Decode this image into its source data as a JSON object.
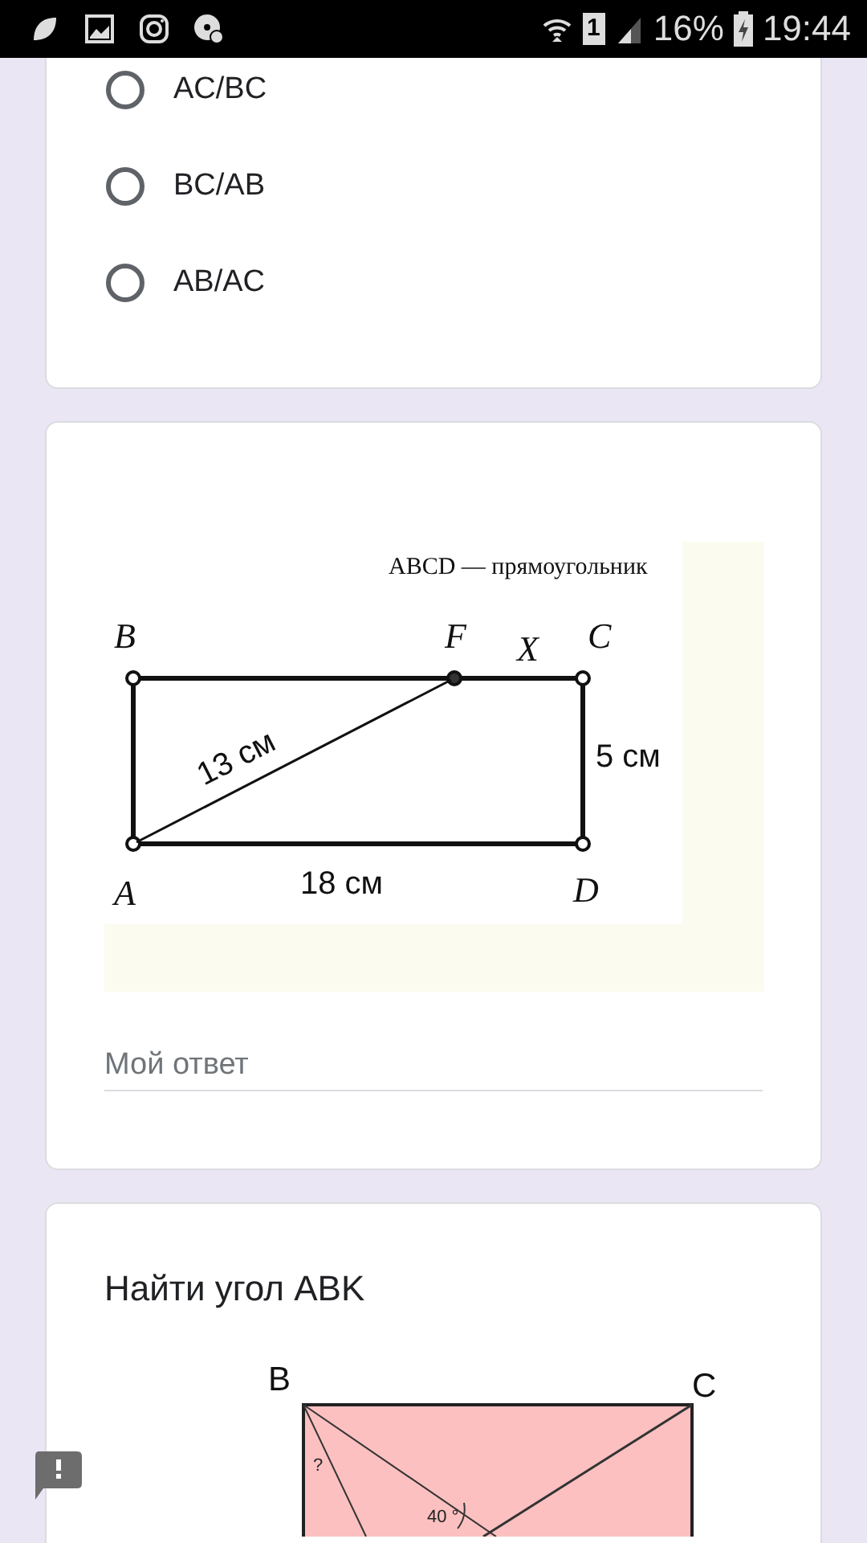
{
  "status_bar": {
    "sim_label": "1",
    "battery": "16%",
    "time": "19:44"
  },
  "question_1": {
    "options": [
      {
        "label": "AC/BC",
        "selected": false
      },
      {
        "label": "BC/AB",
        "selected": false
      },
      {
        "label": "AB/AC",
        "selected": false
      }
    ]
  },
  "question_2": {
    "figure": {
      "caption": "ABCD — прямоугольник",
      "labels": [
        "B",
        "F",
        "X",
        "C",
        "13 см",
        "5 см",
        "A",
        "18 см",
        "D"
      ]
    },
    "answer": {
      "placeholder": "Мой ответ"
    }
  },
  "question_3": {
    "title": "Найти угол ABK",
    "figure": {
      "labels": [
        "B",
        "C",
        "?",
        "40 °"
      ]
    }
  }
}
